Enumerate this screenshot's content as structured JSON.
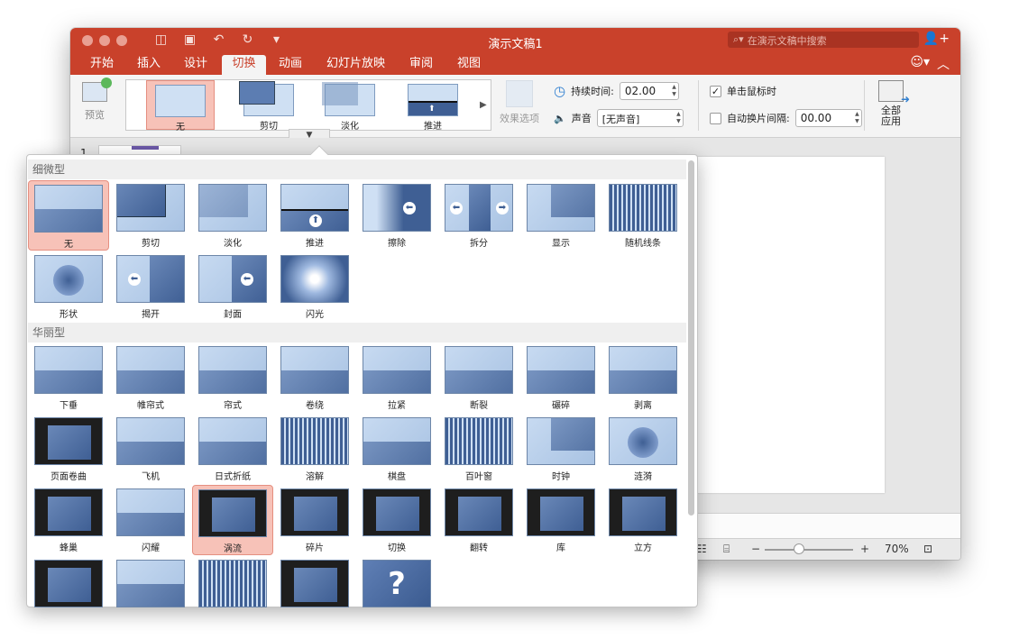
{
  "window": {
    "title": "演示文稿1",
    "search_placeholder": "在演示文稿中搜索"
  },
  "quick_access": [
    "sidebar-icon",
    "save-icon",
    "undo-icon",
    "redo-icon",
    "customize-icon"
  ],
  "tabs": [
    {
      "label": "开始",
      "active": false
    },
    {
      "label": "插入",
      "active": false
    },
    {
      "label": "设计",
      "active": false
    },
    {
      "label": "切换",
      "active": true
    },
    {
      "label": "动画",
      "active": false
    },
    {
      "label": "幻灯片放映",
      "active": false
    },
    {
      "label": "审阅",
      "active": false
    },
    {
      "label": "视图",
      "active": false
    }
  ],
  "ribbon": {
    "preview_label": "预览",
    "gallery": [
      {
        "label": "无",
        "selected": true
      },
      {
        "label": "剪切"
      },
      {
        "label": "淡化"
      },
      {
        "label": "推进"
      }
    ],
    "effect_options_label": "效果选项",
    "duration_label": "持续时间:",
    "duration_value": "02.00",
    "sound_label": "声音",
    "sound_value": "[无声音]",
    "on_click_label": "单击鼠标时",
    "on_click_checked": true,
    "auto_after_label": "自动换片间隔:",
    "auto_after_value": "00.00",
    "auto_after_checked": false,
    "apply_all_line1": "全部",
    "apply_all_line2": "应用"
  },
  "slides": {
    "first_number": "1"
  },
  "status": {
    "zoom": "70%"
  },
  "transitions": {
    "subtle_title": "细微型",
    "subtle": [
      {
        "label": "无",
        "selected": true
      },
      {
        "label": "剪切"
      },
      {
        "label": "淡化"
      },
      {
        "label": "推进"
      },
      {
        "label": "擦除"
      },
      {
        "label": "拆分"
      },
      {
        "label": "显示"
      },
      {
        "label": "随机线条"
      },
      {
        "label": "形状"
      },
      {
        "label": "揭开"
      },
      {
        "label": "封面"
      },
      {
        "label": "闪光"
      }
    ],
    "exciting_title": "华丽型",
    "exciting": [
      {
        "label": "下垂"
      },
      {
        "label": "帷帘式"
      },
      {
        "label": "帘式"
      },
      {
        "label": "卷绕"
      },
      {
        "label": "拉紧"
      },
      {
        "label": "断裂"
      },
      {
        "label": "碾碎"
      },
      {
        "label": "剥离"
      },
      {
        "label": "页面卷曲"
      },
      {
        "label": "飞机"
      },
      {
        "label": "日式折纸"
      },
      {
        "label": "溶解"
      },
      {
        "label": "棋盘"
      },
      {
        "label": "百叶窗"
      },
      {
        "label": "时钟"
      },
      {
        "label": "涟漪"
      },
      {
        "label": "蜂巢"
      },
      {
        "label": "闪耀"
      },
      {
        "label": "涡流",
        "selected": true
      },
      {
        "label": "碎片"
      },
      {
        "label": "切换"
      },
      {
        "label": "翻转"
      },
      {
        "label": "库"
      },
      {
        "label": "立方"
      },
      {
        "label": ""
      },
      {
        "label": ""
      },
      {
        "label": ""
      },
      {
        "label": ""
      },
      {
        "label": ""
      }
    ]
  }
}
